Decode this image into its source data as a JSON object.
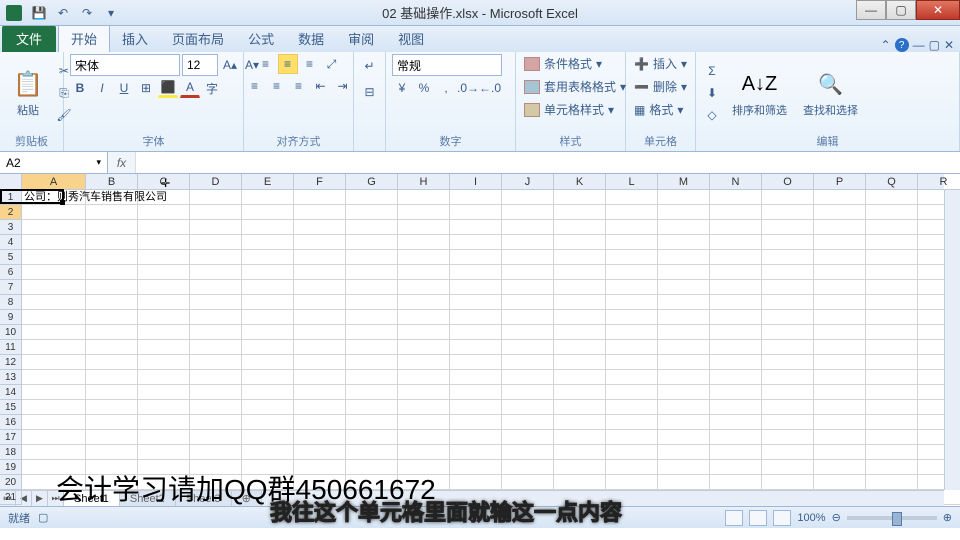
{
  "title": "02 基础操作.xlsx - Microsoft Excel",
  "qat": {
    "save": "💾",
    "undo": "↶",
    "redo": "↷"
  },
  "file_tab": "文件",
  "tabs": [
    "开始",
    "插入",
    "页面布局",
    "公式",
    "数据",
    "审阅",
    "视图"
  ],
  "groups": {
    "clipboard": {
      "label": "剪贴板",
      "paste": "粘贴"
    },
    "font": {
      "label": "字体",
      "name": "宋体",
      "size": "12"
    },
    "alignment": {
      "label": "对齐方式"
    },
    "number": {
      "label": "数字",
      "format": "常规"
    },
    "styles": {
      "label": "样式",
      "cond": "条件格式",
      "table": "套用表格格式",
      "cell": "单元格样式"
    },
    "cells": {
      "label": "单元格",
      "insert": "插入",
      "delete": "删除",
      "format": "格式"
    },
    "editing": {
      "label": "编辑",
      "sort": "排序和筛选",
      "find": "查找和选择"
    }
  },
  "name_box": "A2",
  "columns": [
    "A",
    "B",
    "C",
    "D",
    "E",
    "F",
    "G",
    "H",
    "I",
    "J",
    "K",
    "L",
    "M",
    "N",
    "O",
    "P",
    "Q",
    "R"
  ],
  "rows": [
    1,
    2,
    3,
    4,
    5,
    6,
    7,
    8,
    9,
    10,
    11,
    12,
    13,
    14,
    15,
    16,
    17,
    18,
    19,
    20,
    21
  ],
  "cell_a1": "公司：则秀汽车销售有限公司",
  "sheets": [
    "Sheet1",
    "Sheet2",
    "Sheet3"
  ],
  "status": "就绪",
  "zoom": "100%",
  "overlay1": "会计学习请加QQ群450661672",
  "overlay2": "我往这个单元格里面就输这一点内容"
}
